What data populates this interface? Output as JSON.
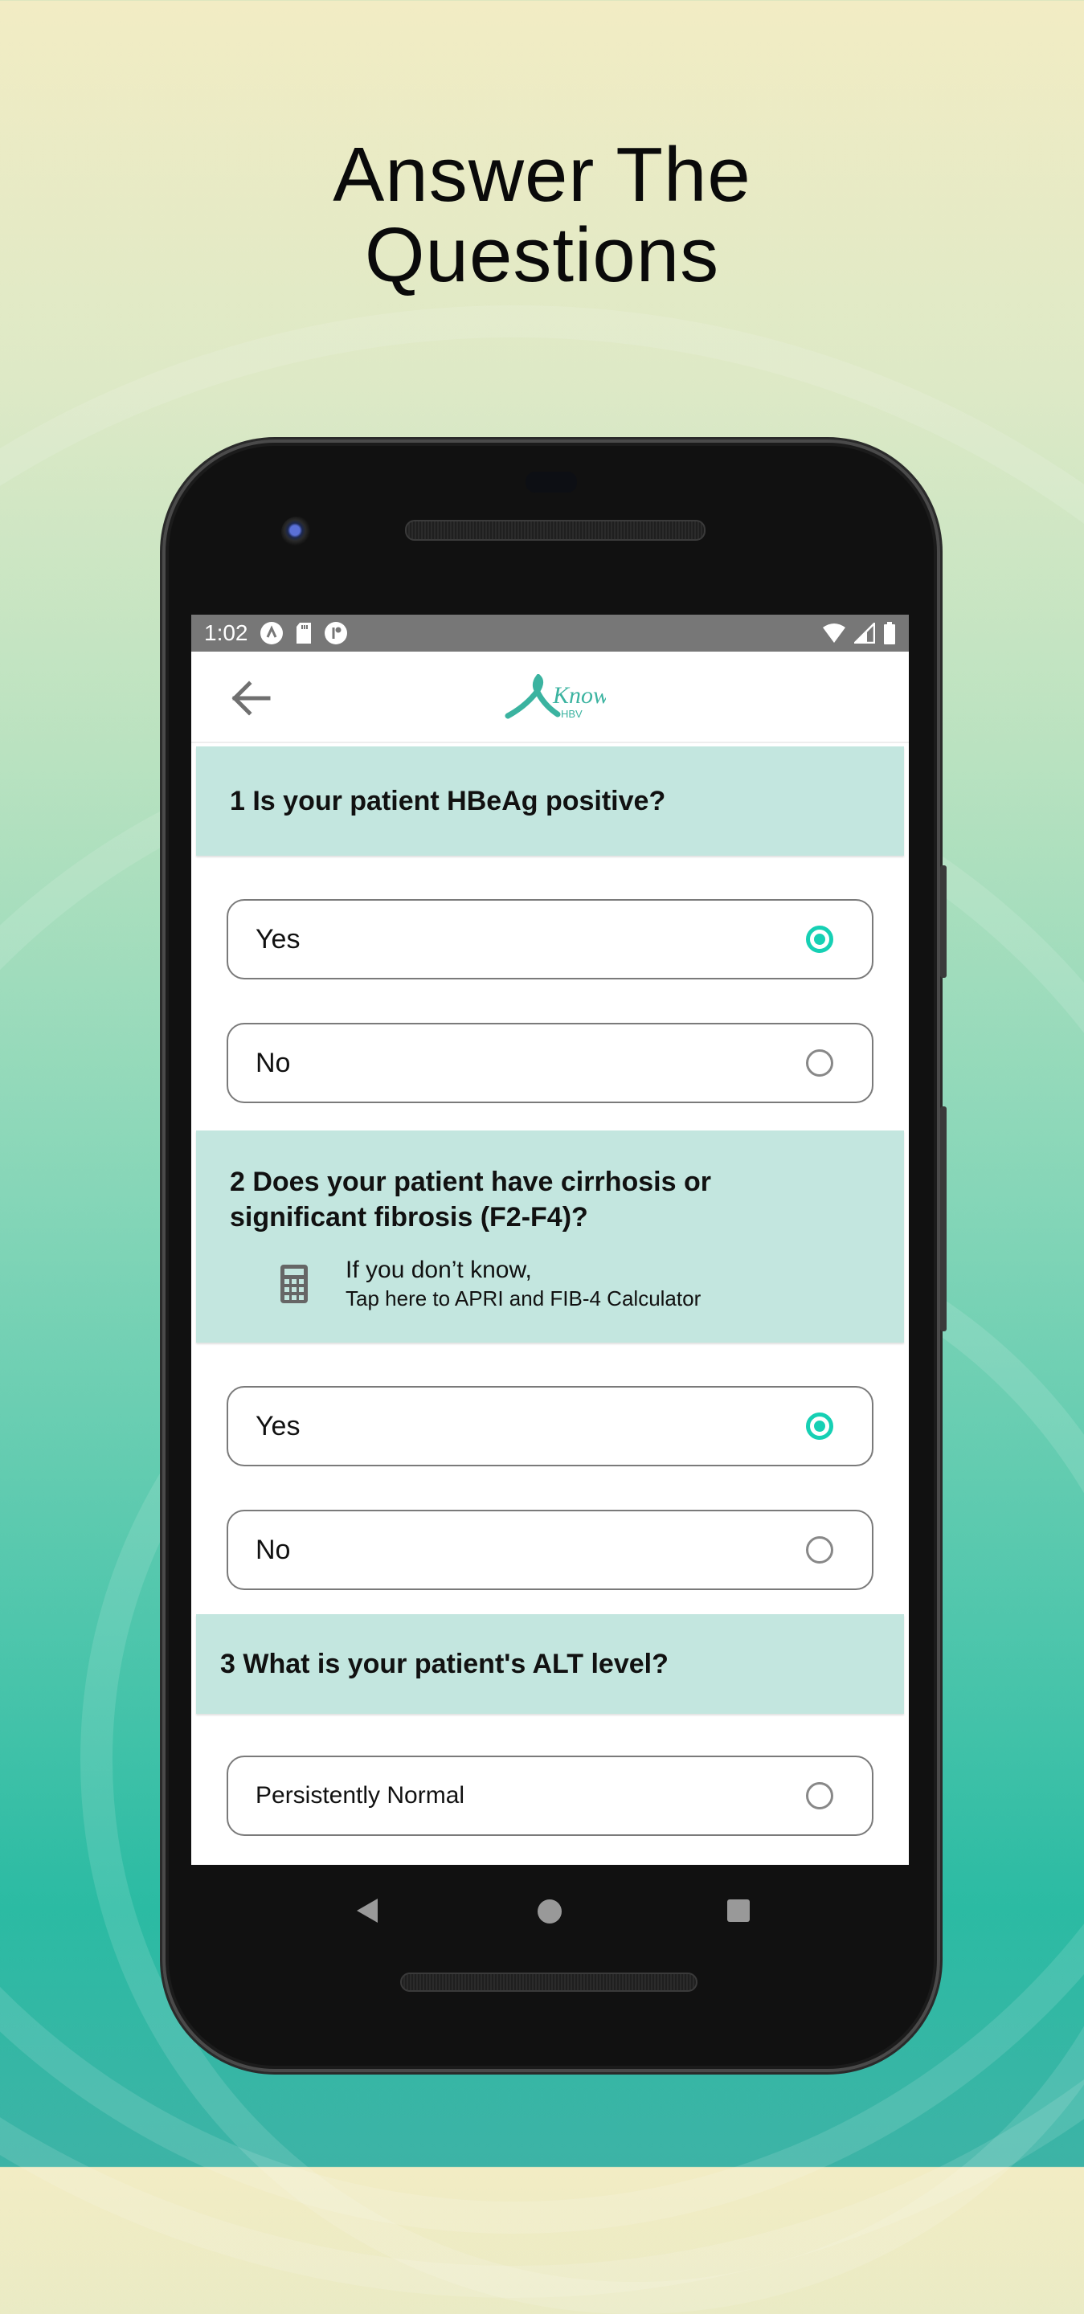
{
  "promo": {
    "headline_line1": "Answer The",
    "headline_line2": "Questions"
  },
  "colors": {
    "accent": "#16d0b4",
    "question_bg": "#c3e6df",
    "statusbar_bg": "#777777",
    "logo": "#3bb3a0"
  },
  "statusbar": {
    "time": "1:02",
    "left_icons": [
      "app-notification-icon",
      "sd-card-icon",
      "app-badge-icon"
    ],
    "right_icons": [
      "wifi-icon",
      "cell-signal-icon",
      "battery-icon"
    ]
  },
  "appbar": {
    "back_icon": "arrow-left-icon",
    "logo_text": "Know",
    "logo_subtext": "HBV"
  },
  "questions": [
    {
      "number": "1",
      "text": "1 Is your patient HBeAg positive?",
      "options": [
        {
          "label": "Yes",
          "selected": true
        },
        {
          "label": "No",
          "selected": false
        }
      ]
    },
    {
      "number": "2",
      "text_line1": "2 Does your patient have cirrhosis or",
      "text_line2": "significant fibrosis (F2-F4)?",
      "helper": {
        "icon": "calculator-icon",
        "line1": "If you don’t know,",
        "line2": "Tap here to APRI and FIB-4 Calculator"
      },
      "options": [
        {
          "label": "Yes",
          "selected": true
        },
        {
          "label": "No",
          "selected": false
        }
      ]
    },
    {
      "number": "3",
      "text": "3 What is your patient's ALT level?",
      "options": [
        {
          "label": "Persistently Normal",
          "selected": false
        }
      ]
    }
  ],
  "navbar": {
    "back": "nav-back-icon",
    "home": "nav-home-icon",
    "recents": "nav-recents-icon"
  }
}
